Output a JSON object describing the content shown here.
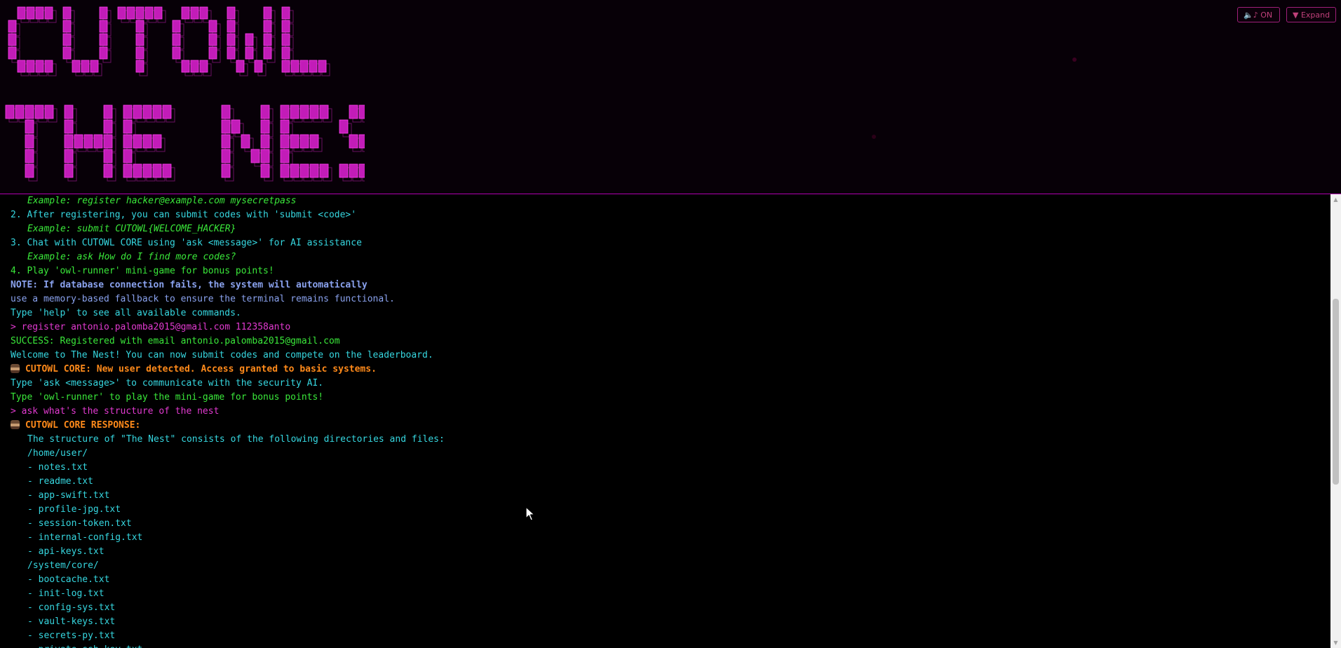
{
  "banner": {
    "logo_text": "CUTOWL THE NEST",
    "logo_lines": [
      "CUTOWL",
      "THE NEST"
    ]
  },
  "header_controls": {
    "sound": {
      "icon": "speaker-music-icon",
      "label": "🔈♪ ON"
    },
    "expand": {
      "icon": "triangle-down-icon",
      "label": "▼ Expand"
    }
  },
  "colors": {
    "accent": "#e23ad0",
    "info": "#36d7e0",
    "success": "#3ae83a",
    "note": "#8aa2ee",
    "ai": "#ff8a1a",
    "background": "#000000"
  },
  "terminal": {
    "lines": [
      {
        "text": "Example: register hacker@example.com mysecretpass",
        "style": "green-i",
        "indent": true
      },
      {
        "text": "2. After registering, you can submit codes with 'submit <code>'",
        "style": "cyan"
      },
      {
        "text": "Example: submit CUTOWL{WELCOME_HACKER}",
        "style": "green-i",
        "indent": true
      },
      {
        "text": "3. Chat with CUTOWL CORE using 'ask <message>' for AI assistance",
        "style": "cyan"
      },
      {
        "text": "Example: ask How do I find more codes?",
        "style": "green-i",
        "indent": true
      },
      {
        "text": "4. Play 'owl-runner' mini-game for bonus points!",
        "style": "green"
      },
      {
        "text": "NOTE: If database connection fails, the system will automatically",
        "style": "blue-bold"
      },
      {
        "text": "use a memory-based fallback to ensure the terminal remains functional.",
        "style": "blue"
      },
      {
        "text": "Type 'help' to see all available commands.",
        "style": "cyan"
      },
      {
        "text": "> register antonio.palomba2015@gmail.com 112358anto",
        "style": "magenta"
      },
      {
        "text": "SUCCESS: Registered with email antonio.palomba2015@gmail.com",
        "style": "green"
      },
      {
        "text": "Welcome to The Nest! You can now submit codes and compete on the leaderboard.",
        "style": "cyan"
      },
      {
        "text": "CUTOWL CORE: New user detected. Access granted to basic systems.",
        "style": "orange",
        "icon": "owl-avatar-icon"
      },
      {
        "text": "Type 'ask <message>' to communicate with the security AI.",
        "style": "cyan"
      },
      {
        "text": "Type 'owl-runner' to play the mini-game for bonus points!",
        "style": "green"
      },
      {
        "text": "> ask what's the structure of the nest",
        "style": "magenta"
      },
      {
        "text": "CUTOWL CORE RESPONSE:",
        "style": "orange",
        "icon": "owl-avatar-icon"
      },
      {
        "text": "The structure of \"The Nest\" consists of the following directories and files:",
        "style": "cyan",
        "indent": true
      },
      {
        "text": "/home/user/",
        "style": "cyan",
        "indent": true
      },
      {
        "text": "- notes.txt",
        "style": "cyan",
        "indent": true
      },
      {
        "text": "- readme.txt",
        "style": "cyan",
        "indent": true
      },
      {
        "text": "- app-swift.txt",
        "style": "cyan",
        "indent": true
      },
      {
        "text": "- profile-jpg.txt",
        "style": "cyan",
        "indent": true
      },
      {
        "text": "- session-token.txt",
        "style": "cyan",
        "indent": true
      },
      {
        "text": "- internal-config.txt",
        "style": "cyan",
        "indent": true
      },
      {
        "text": "- api-keys.txt",
        "style": "cyan",
        "indent": true
      },
      {
        "text": "/system/core/",
        "style": "cyan",
        "indent": true
      },
      {
        "text": "- bootcache.txt",
        "style": "cyan",
        "indent": true
      },
      {
        "text": "- init-log.txt",
        "style": "cyan",
        "indent": true
      },
      {
        "text": "- config-sys.txt",
        "style": "cyan",
        "indent": true
      },
      {
        "text": "- vault-keys.txt",
        "style": "cyan",
        "indent": true
      },
      {
        "text": "- secrets-py.txt",
        "style": "cyan",
        "indent": true
      },
      {
        "text": "- private-ssh-key.txt",
        "style": "cyan",
        "indent": true
      }
    ]
  },
  "scrollbar": {
    "up_icon": "scroll-up-arrow-icon",
    "down_icon": "scroll-down-arrow-icon",
    "position_fraction": 0.2,
    "visible_fraction": 0.43
  },
  "cursor": {
    "icon": "mouse-pointer-icon"
  }
}
